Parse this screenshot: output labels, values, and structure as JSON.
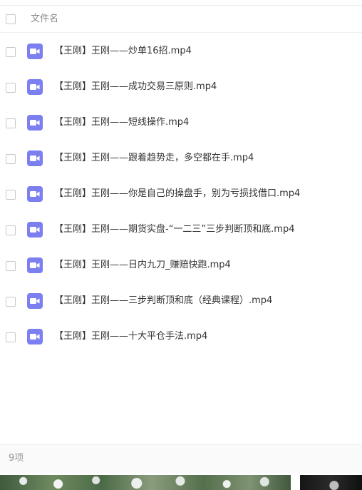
{
  "header": {
    "column_label": "文件名"
  },
  "files": [
    {
      "name": "【王刚】王刚——炒单16招.mp4",
      "icon": "video-file-icon"
    },
    {
      "name": "【王刚】王刚——成功交易三原则.mp4",
      "icon": "video-file-icon"
    },
    {
      "name": "【王刚】王刚——短线操作.mp4",
      "icon": "video-file-icon"
    },
    {
      "name": "【王刚】王刚——跟着趋势走，多空都在手.mp4",
      "icon": "video-file-icon"
    },
    {
      "name": "【王刚】王刚——你是自己的操盘手，别为亏损找借口.mp4",
      "icon": "video-file-icon"
    },
    {
      "name": "【王刚】王刚——期货实盘-“一二三”三步判断顶和底.mp4",
      "icon": "video-file-icon"
    },
    {
      "name": "【王刚】王刚——日内九刀_赚赔快跑.mp4",
      "icon": "video-file-icon"
    },
    {
      "name": "【王刚】王刚——三步判断顶和底（经典课程）.mp4",
      "icon": "video-file-icon"
    },
    {
      "name": "【王刚】王刚——十大平仓手法.mp4",
      "icon": "video-file-icon"
    }
  ],
  "footer": {
    "count": "9项"
  },
  "colors": {
    "icon_accent": "#7b7ff0",
    "text": "#333333",
    "muted": "#999999"
  }
}
